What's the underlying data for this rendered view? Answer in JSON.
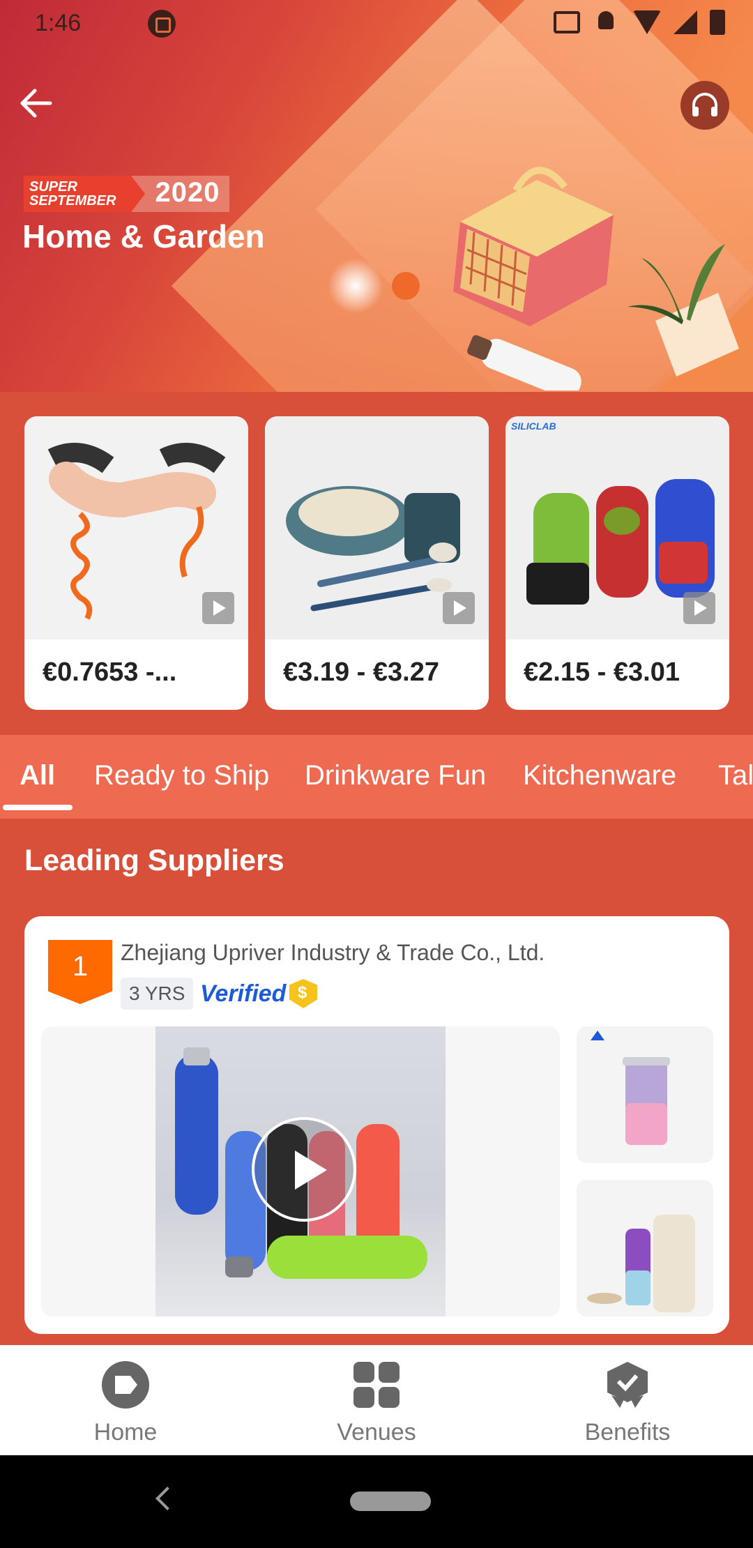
{
  "status_bar": {
    "time": "1:46"
  },
  "hero": {
    "promo_line1": "SUPER",
    "promo_line2": "SEPTEMBER",
    "promo_year": "2020",
    "title": "Home & Garden"
  },
  "products": [
    {
      "price": "€0.7653 -..."
    },
    {
      "price": "€3.19 - €3.27"
    },
    {
      "price": "€2.15 - €3.01",
      "brand": "SILICLAB"
    }
  ],
  "tabs": [
    {
      "label": "All"
    },
    {
      "label": "Ready to Ship"
    },
    {
      "label": "Drinkware Fun"
    },
    {
      "label": "Kitchenware"
    },
    {
      "label": "Tal"
    }
  ],
  "section": {
    "title": "Leading Suppliers"
  },
  "supplier": {
    "rank": "1",
    "name": "Zhejiang Upriver Industry & Trade Co., Ltd.",
    "years": "3 YRS",
    "verified": "Verified"
  },
  "bottom_nav": [
    {
      "label": "Home"
    },
    {
      "label": "Venues"
    },
    {
      "label": "Benefits"
    }
  ],
  "colors": {
    "accent": "#ff6a00",
    "page_bg": "#d9503a",
    "tab_bg": "#ee6a50",
    "verified": "#1d5bd6"
  }
}
